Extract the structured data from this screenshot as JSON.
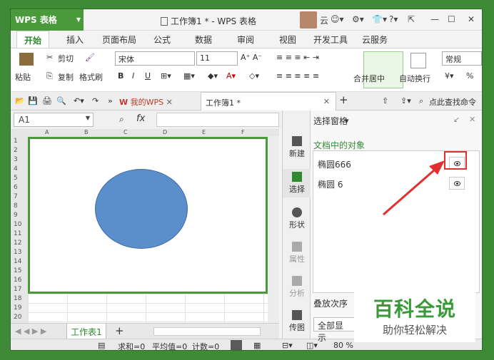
{
  "app": {
    "name": "WPS 表格",
    "doc_title": "工作簿1 * - WPS 表格",
    "user": "云"
  },
  "menu": [
    "开始",
    "插入",
    "页面布局",
    "公式",
    "数据",
    "审阅",
    "视图",
    "开发工具",
    "云服务"
  ],
  "ribbon": {
    "paste": "粘贴",
    "cut": "剪切",
    "copy": "复制",
    "format_painter": "格式刷",
    "font": "宋体",
    "size": "11",
    "merge": "合并居中",
    "wrap": "自动换行",
    "number_format": "常规",
    "percent": "%"
  },
  "tabs": {
    "mywps": "我的WPS",
    "doc": "工作簿1 *",
    "search": "点此查找命令"
  },
  "formula": {
    "cell": "A1",
    "fx": "fx"
  },
  "columns": [
    "A",
    "B",
    "C",
    "D",
    "E",
    "F"
  ],
  "rows": [
    "1",
    "2",
    "3",
    "4",
    "5",
    "6",
    "7",
    "8",
    "9",
    "10",
    "11",
    "12",
    "13",
    "14",
    "15",
    "16",
    "17",
    "18",
    "19",
    "20"
  ],
  "sheet_tab": "工作表1",
  "status": {
    "sum": "求和=0",
    "avg": "平均值=0",
    "count": "计数=0",
    "zoom": "80 %"
  },
  "sidebar": [
    "新建",
    "选择",
    "形状",
    "属性",
    "分析",
    "传图"
  ],
  "pane": {
    "title": "选择窗格",
    "objects_label": "文档中的对象",
    "objects": [
      "椭圆666",
      "椭圆 6"
    ],
    "order_label": "叠放次序",
    "show_all": "全部显示"
  },
  "watermark": {
    "title": "百科全说",
    "subtitle": "助你轻松解决"
  },
  "colors": {
    "accent": "#4a9a3b",
    "shape": "#5b8fcc",
    "arrow": "#e03030"
  }
}
